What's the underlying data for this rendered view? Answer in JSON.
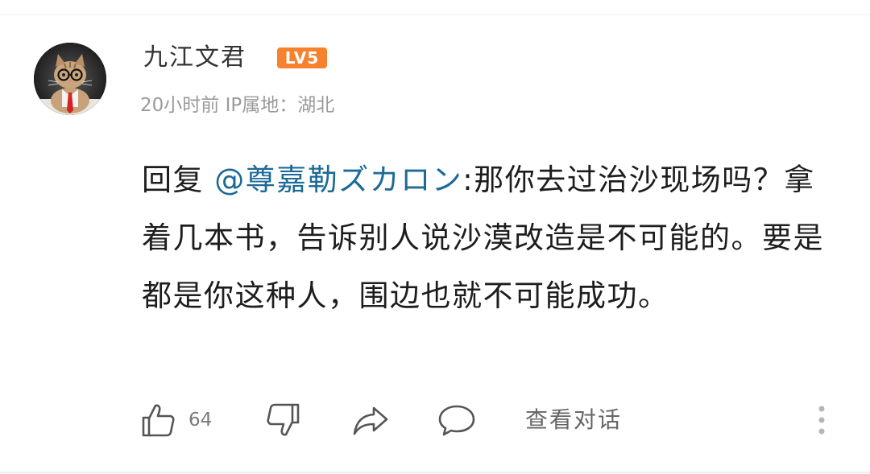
{
  "comment": {
    "author": {
      "name": "九江文君",
      "level": "LV5",
      "avatar_icon": "cat-with-glasses-avatar"
    },
    "meta": {
      "time": "20小时前",
      "location": "IP属地：湖北"
    },
    "reply_prefix": "回复 ",
    "mention": "@尊嘉勒ズカロン",
    "body": ":那你去过治沙现场吗？拿着几本书，告诉别人说沙漠改造是不可能的。要是都是你这种人，围边也就不可能成功。",
    "colors": {
      "mention": "#1c6a96",
      "level_badge": "#f7822d",
      "text": "#1d1d1d",
      "meta": "#9a9a9a"
    }
  },
  "actions": {
    "like_icon": "thumbs-up-icon",
    "like_count": "64",
    "dislike_icon": "thumbs-down-icon",
    "share_icon": "share-arrow-icon",
    "reply_icon": "speech-bubble-icon",
    "view_conversation": "查看对话",
    "more_icon": "more-vertical-icon"
  }
}
